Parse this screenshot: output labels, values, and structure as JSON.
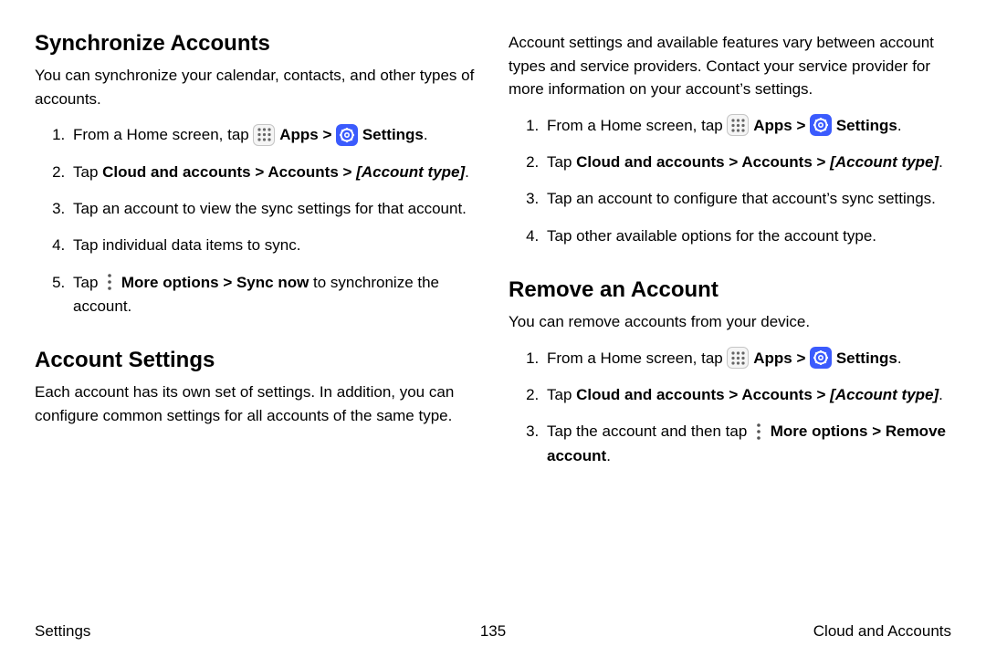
{
  "left": {
    "sync": {
      "heading": "Synchronize Accounts",
      "intro": "You can synchronize your calendar, contacts, and other types of accounts.",
      "step1_a": "From a Home screen, tap ",
      "step1_apps": " Apps",
      "step1_gt": " > ",
      "step1_settings": " Settings",
      "step1_end": ".",
      "step2_a": "Tap ",
      "step2_path": "Cloud and accounts > Accounts > ",
      "step2_type": "[Account type]",
      "step2_end": ".",
      "step3": "Tap an account to view the sync settings for that account.",
      "step4": "Tap individual data items to sync.",
      "step5_a": "Tap ",
      "step5_b": " More options > Sync now",
      "step5_c": " to synchronize the account."
    },
    "acct": {
      "heading": "Account Settings",
      "intro": "Each account has its own set of settings. In addition, you can configure common settings for all accounts of the same type."
    }
  },
  "right": {
    "intro": "Account settings and available features vary between account types and service providers. Contact your service provider for more information on your account’s settings.",
    "step1_a": "From a Home screen, tap ",
    "step1_apps": " Apps",
    "step1_gt": " > ",
    "step1_settings": " Settings",
    "step1_end": ".",
    "step2_a": "Tap ",
    "step2_path": "Cloud and accounts > Accounts > ",
    "step2_type": "[Account type]",
    "step2_end": ".",
    "step3": "Tap an account to configure that account’s sync settings.",
    "step4": "Tap other available options for the account type.",
    "remove": {
      "heading": "Remove an Account",
      "intro": "You can remove accounts from your device.",
      "step1_a": "From a Home screen, tap ",
      "step1_apps": " Apps",
      "step1_gt": " > ",
      "step1_settings": " Settings",
      "step1_end": ".",
      "step2_a": "Tap ",
      "step2_path": "Cloud and accounts > Accounts > ",
      "step2_type": "[Account type]",
      "step2_end": ".",
      "step3_a": "Tap the account and then tap ",
      "step3_b": " More options > Remove account",
      "step3_c": "."
    }
  },
  "footer": {
    "left": "Settings",
    "page": "135",
    "right": "Cloud and Accounts"
  }
}
